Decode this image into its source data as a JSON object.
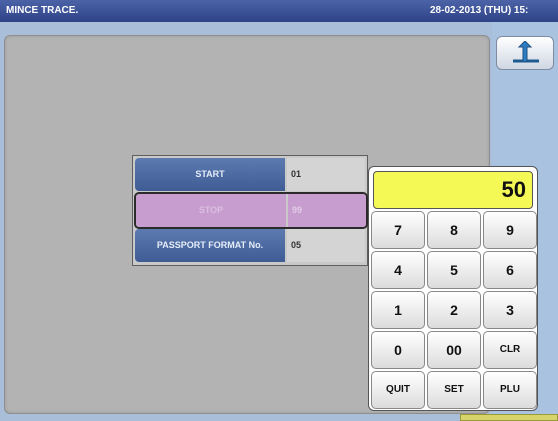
{
  "header": {
    "title": "MINCE TRACE.",
    "datetime": "28-02-2013 (THU)  15:"
  },
  "settings": [
    {
      "label": "START",
      "value": "01"
    },
    {
      "label": "STOP",
      "value": "99"
    },
    {
      "label": "PASSPORT FORMAT No.",
      "value": "05"
    }
  ],
  "keypad": {
    "display": "50",
    "keys": [
      "7",
      "8",
      "9",
      "4",
      "5",
      "6",
      "1",
      "2",
      "3",
      "0",
      "00",
      "CLR",
      "QUIT",
      "SET",
      "PLU"
    ]
  },
  "icons": {
    "back": "return-arrow-icon"
  },
  "colors": {
    "display_bg": "#f5f955",
    "selected_row": "#c79cce",
    "label_bg": "#4a67a0"
  }
}
